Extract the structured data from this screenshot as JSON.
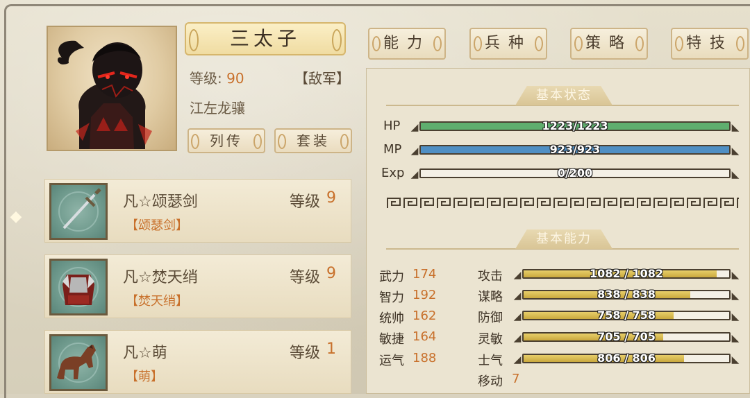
{
  "general": {
    "name": "三太子",
    "level_label": "等级:",
    "level_value": "90",
    "faction": "【敌军】",
    "title": "江左龙骧"
  },
  "buttons": {
    "biography": "列传",
    "outfit": "套装"
  },
  "tabs": [
    "能力",
    "兵种",
    "策略",
    "特技"
  ],
  "side_arrow": "◆",
  "equipment": [
    {
      "name": "凡☆颂瑟剑",
      "sub": "【颂瑟剑】",
      "level_label": "等级",
      "level": "9",
      "icon": "sword-icon"
    },
    {
      "name": "凡☆焚天绡",
      "sub": "【焚天绡】",
      "level_label": "等级",
      "level": "9",
      "icon": "armor-icon"
    },
    {
      "name": "凡☆萌",
      "sub": "【萌】",
      "level_label": "等级",
      "level": "1",
      "icon": "horse-icon"
    }
  ],
  "basic_status": {
    "header": "基本状态",
    "bars": [
      {
        "label": "HP",
        "text": "1223/1223",
        "fill": 1.0,
        "color": "#5fae6e"
      },
      {
        "label": "MP",
        "text": "923/923",
        "fill": 1.0,
        "color": "#4f8fc4"
      },
      {
        "label": "Exp",
        "text": "0/200",
        "fill": 0.0,
        "color": "#d4b24a"
      }
    ]
  },
  "basic_ability": {
    "header": "基本能力",
    "attributes": [
      {
        "label": "武力",
        "value": "174"
      },
      {
        "label": "智力",
        "value": "192"
      },
      {
        "label": "统帅",
        "value": "162"
      },
      {
        "label": "敏捷",
        "value": "164"
      },
      {
        "label": "运气",
        "value": "188"
      }
    ],
    "combat": [
      {
        "label": "攻击",
        "text": "1082 / 1082",
        "fill": 0.94
      },
      {
        "label": "谋略",
        "text": "838 / 838",
        "fill": 0.81
      },
      {
        "label": "防御",
        "text": "758 / 758",
        "fill": 0.73
      },
      {
        "label": "灵敏",
        "text": "705 / 705",
        "fill": 0.68
      },
      {
        "label": "士气",
        "text": "806 / 806",
        "fill": 0.78
      }
    ],
    "move_label": "移动",
    "move_value": "7"
  }
}
